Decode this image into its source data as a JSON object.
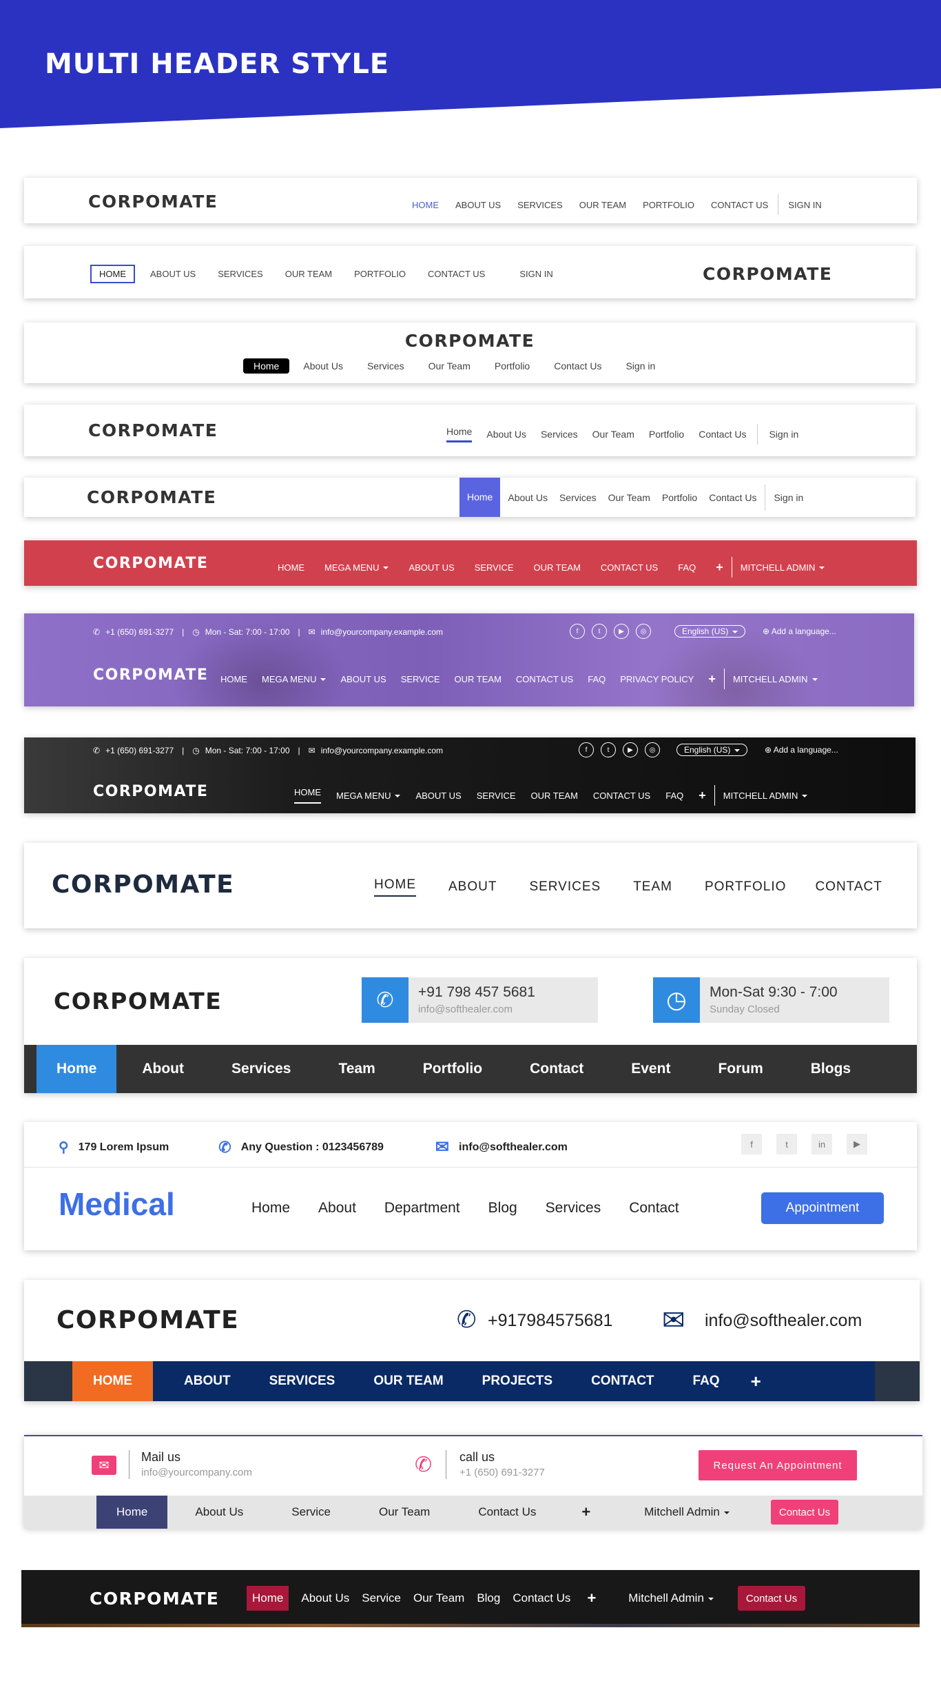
{
  "banner": {
    "title": "MULTI HEADER STYLE",
    "color": "#2b32c2"
  },
  "h1": {
    "logo": "CORPOMATE",
    "nav": [
      "HOME",
      "ABOUT US",
      "SERVICES",
      "OUR TEAM",
      "PORTFOLIO",
      "CONTACT US"
    ],
    "signin": "SIGN IN",
    "active_color": "#4a5fd8"
  },
  "h2": {
    "logo": "CORPOMATE",
    "nav": [
      "HOME",
      "ABOUT US",
      "SERVICES",
      "OUR TEAM",
      "PORTFOLIO",
      "CONTACT US",
      "SIGN IN"
    ]
  },
  "h3": {
    "logo": "CORPOMATE",
    "nav": [
      "Home",
      "About Us",
      "Services",
      "Our Team",
      "Portfolio",
      "Contact Us",
      "Sign in"
    ]
  },
  "h4": {
    "logo": "CORPOMATE",
    "nav": [
      "Home",
      "About Us",
      "Services",
      "Our Team",
      "Portfolio",
      "Contact Us"
    ],
    "signin": "Sign in"
  },
  "h5": {
    "logo": "CORPOMATE",
    "nav": [
      "Home",
      "About Us",
      "Services",
      "Our Team",
      "Portfolio",
      "Contact Us"
    ],
    "signin": "Sign in",
    "active_color": "#5b64e0"
  },
  "h6": {
    "logo": "CORPOMATE",
    "nav": [
      "HOME",
      "MEGA MENU",
      "ABOUT US",
      "SERVICE",
      "OUR TEAM",
      "CONTACT US",
      "FAQ"
    ],
    "plus": "+",
    "user": "MITCHELL ADMIN",
    "bg": "#d0414d"
  },
  "h7": {
    "phone": "+1 (650) 691-3277",
    "hours": "Mon - Sat: 7:00 - 17:00",
    "email": "info@yourcompany.example.com",
    "language": "English (US)",
    "add_language": "Add a language...",
    "logo": "CORPOMATE",
    "nav": [
      "HOME",
      "MEGA MENU",
      "ABOUT US",
      "SERVICE",
      "OUR TEAM",
      "CONTACT US",
      "FAQ",
      "PRIVACY POLICY"
    ],
    "plus": "+",
    "user": "MITCHELL ADMIN",
    "bg": "#8b6bc2"
  },
  "h8": {
    "phone": "+1 (650) 691-3277",
    "hours": "Mon - Sat: 7:00 - 17:00",
    "email": "info@yourcompany.example.com",
    "language": "English (US)",
    "add_language": "Add a language...",
    "logo": "CORPOMATE",
    "nav": [
      "HOME",
      "MEGA MENU",
      "ABOUT US",
      "SERVICE",
      "OUR TEAM",
      "CONTACT US",
      "FAQ"
    ],
    "plus": "+",
    "user": "MITCHELL ADMIN"
  },
  "h9": {
    "logo": "CORPOMATE",
    "nav": [
      "HOME",
      "ABOUT",
      "SERVICES",
      "TEAM",
      "PORTFOLIO",
      "CONTACT"
    ]
  },
  "h10": {
    "logo": "CORPOMATE",
    "phone": "+91 798 457 5681",
    "email": "info@softhealer.com",
    "hours": "Mon-Sat 9:30 - 7:00",
    "closed": "Sunday Closed",
    "nav": [
      "Home",
      "About",
      "Services",
      "Team",
      "Portfolio",
      "Contact",
      "Event",
      "Forum",
      "Blogs"
    ],
    "accent": "#2f8be0"
  },
  "h11": {
    "address": "179 Lorem Ipsum",
    "question": "Any Question : 0123456789",
    "email": "info@softhealer.com",
    "logo": "Medical",
    "nav": [
      "Home",
      "About",
      "Department",
      "Blog",
      "Services",
      "Contact"
    ],
    "cta": "Appointment",
    "accent": "#3d6fe6"
  },
  "h12": {
    "logo": "CORPOMATE",
    "phone": "+917984575681",
    "email": "info@softhealer.com",
    "nav": [
      "HOME",
      "ABOUT",
      "SERVICES",
      "OUR TEAM",
      "PROJECTS",
      "CONTACT",
      "FAQ"
    ],
    "plus": "+",
    "accent": "#f26b22",
    "navbg": "#0a2a66"
  },
  "h13": {
    "mail_label": "Mail us",
    "mail_value": "info@yourcompany.com",
    "call_label": "call us",
    "call_value": "+1 (650) 691-3277",
    "cta": "Request An Appointment",
    "nav": [
      "Home",
      "About Us",
      "Service",
      "Our Team",
      "Contact Us"
    ],
    "plus": "+",
    "user": "Mitchell Admin",
    "contact_btn": "Contact Us",
    "accent": "#f0407a"
  },
  "h14": {
    "logo": "CORPOMATE",
    "nav": [
      "Home",
      "About Us",
      "Service",
      "Our Team",
      "Blog",
      "Contact Us"
    ],
    "plus": "+",
    "user": "Mitchell Admin",
    "contact_btn": "Contact Us",
    "accent": "#a8183a"
  }
}
